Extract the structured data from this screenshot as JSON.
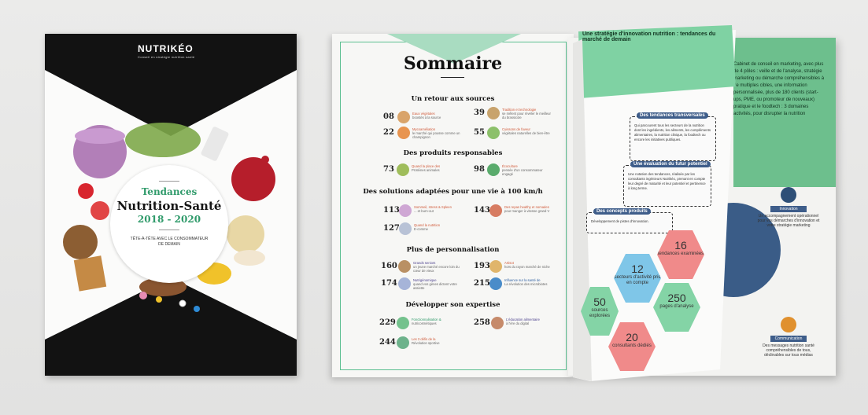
{
  "cover": {
    "logo": "NUTRIKÉO",
    "logo_tagline": "Conseil en stratégie nutrition santé",
    "title_line1": "Tendances",
    "title_line2": "Nutrition-Santé",
    "title_years": "2018 - 2020",
    "subtitle": "TÊTE-À-TÊTE AVEC LE CONSOMMATEUR DE DEMAIN"
  },
  "sommaire": {
    "title": "Sommaire",
    "sections": [
      {
        "title": "Un retour aux sources",
        "entries": [
          {
            "page": "08",
            "label": "Eaux végétales",
            "sub": "boostés à la source"
          },
          {
            "page": "39",
            "label": "Tradition et technologie",
            "sub": "se mêlent pour révéler le meilleur du brassicole"
          },
          {
            "page": "22",
            "label": "Mycoaméliation",
            "sub": "le marché qui pousse comme un champignon"
          },
          {
            "page": "55",
            "label": "Cuissons de faveur",
            "sub": "végétales naturelles de bien-être"
          }
        ]
      },
      {
        "title": "Des produits responsables",
        "entries": [
          {
            "page": "73",
            "label": "Quand la place des",
            "sub": "Protéines animales"
          },
          {
            "page": "98",
            "label": "Écoculture",
            "sub": "pensée d'un consommateur engagé"
          }
        ]
      },
      {
        "title": "Des solutions adaptées pour une vie à 100 km/h",
        "entries": [
          {
            "page": "113",
            "label": "Sommeil, stress & Spleen",
            "sub": "... et burn-out"
          },
          {
            "page": "143",
            "label": "Des repas healthy et nomades",
            "sub": "pour manger à vitesse grand V"
          },
          {
            "page": "127",
            "label": "Quand la nutrition",
            "sub": "E-comme"
          }
        ]
      },
      {
        "title": "Plus de personnalisation",
        "entries": [
          {
            "page": "160",
            "label": "Grands seniors",
            "sub": "un jeune marché encore loin du cœur de vieux"
          },
          {
            "page": "193",
            "label": "Artisot",
            "sub": "hors du rayon marché de niche"
          },
          {
            "page": "174",
            "label": "Nutrigénomique",
            "sub": "quand vos gènes dictent votre assiette"
          },
          {
            "page": "215",
            "label": "Influence sur la santé de",
            "sub": "La révolution des microbiotes"
          }
        ]
      },
      {
        "title": "Développer son expertise",
        "entries": [
          {
            "page": "229",
            "label": "Fonctionnalisation &",
            "sub": "nutricosmétiques"
          },
          {
            "page": "258",
            "label": "L'éducation alimentaire",
            "sub": "à l'ère du digital"
          },
          {
            "page": "244",
            "label": "Les 3 défis de la",
            "sub": "Révolution sportive"
          }
        ]
      }
    ]
  },
  "insert": {
    "header": "Une stratégie d'innovation nutrition : tendances du marché de demain",
    "boxes": [
      {
        "title": "Des tendances transversales",
        "text": "Qui parcourent tous les secteurs de la nutrition dont les ingrédients, les aliments, les compléments alimentaires, la nutrition clinique, la foodtech ou encore les initiatives publiques."
      },
      {
        "title": "Une évaluation du futur potentiel",
        "text": "Une notation des tendances, réalisée par les consultants ingénieurs Nutrikéo, prenant en compte leur degré de maturité et leur potentiel et pertinence à long terme."
      },
      {
        "title": "Des concepts produits",
        "text": "Développement de pistes d'innovation."
      }
    ],
    "hexes": [
      {
        "num": "16",
        "label": "tendances examinées",
        "color": "#f08a8a"
      },
      {
        "num": "12",
        "label": "secteurs d'activité pris en compte",
        "color": "#7fc6e8"
      },
      {
        "num": "250",
        "label": "pages d'analyse",
        "color": "#84d4a6"
      },
      {
        "num": "20",
        "label": "consultants dédiés",
        "color": "#f08a8a"
      },
      {
        "num": "50",
        "label": "sources explorées",
        "color": "#84d4a6"
      }
    ]
  },
  "right_page": {
    "green_text": "Cabinet de conseil en marketing, avec plus de 4 pôles : veille et de l'analyse, stratégie marketing ou démarche compréhensibles à de multiples cibles, une information personnalisée, plus de 180 clients (start-ups, PME, ou promoteur de nouveaux) pratique et le foodtech : 3 domaines activités, pour disrupter la nutrition",
    "innovation_label": "Innovation",
    "innovation_text": "Un accompagnement opérationnel pour vos démarches d'innovation et votre stratégie marketing",
    "communication_label": "Communication",
    "communication_text": "Des messages nutrition santé compréhensibles de tous, déclinables sur tous médias"
  },
  "colors": {
    "green": "#2f9a6a",
    "dark": "#121212",
    "mint": "#6dbf8d",
    "navy": "#3e5d8a"
  }
}
